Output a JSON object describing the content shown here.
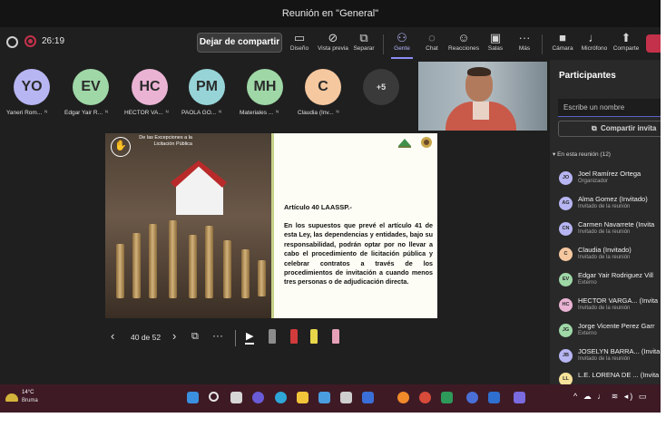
{
  "window": {
    "title": "Reunión en \"General\""
  },
  "toolbar": {
    "timer": "26:19",
    "stop_sharing_label": "Dejar de compartir",
    "buttons": [
      {
        "label": "Diseño",
        "icon": "layout-icon"
      },
      {
        "label": "Vista previa",
        "icon": "eye-off-icon"
      },
      {
        "label": "Separar",
        "icon": "popout-icon"
      },
      {
        "label": "Gente",
        "icon": "people-icon"
      },
      {
        "label": "Chat",
        "icon": "chat-icon"
      },
      {
        "label": "Reacciones",
        "icon": "reactions-icon"
      },
      {
        "label": "Salas",
        "icon": "rooms-icon"
      },
      {
        "label": "Más",
        "icon": "more-icon"
      },
      {
        "label": "Cámara",
        "icon": "camera-icon"
      },
      {
        "label": "Micrófono",
        "icon": "mic-off-icon"
      },
      {
        "label": "Comparte",
        "icon": "share-icon"
      }
    ]
  },
  "participants_strip": [
    {
      "initials": "YO",
      "name": "Yaneri Rom...",
      "color": "#b7b5f2"
    },
    {
      "initials": "EV",
      "name": "Edgar Yair R...",
      "color": "#9fd7a7"
    },
    {
      "initials": "HC",
      "name": "HECTOR VA...",
      "color": "#eab3d4"
    },
    {
      "initials": "PM",
      "name": "PAOLA GO...",
      "color": "#97d4d8"
    },
    {
      "initials": "MH",
      "name": "Materiales ...",
      "color": "#9fd7a7"
    },
    {
      "initials": "C",
      "name": "Claudia (Inv...",
      "color": "#f6c8a0"
    }
  ],
  "overflow_count": "+5",
  "slide": {
    "ribbon_text": "De las Excepciones a la Licitación Pública",
    "article_title": "Artículo 40 LAASSP.-",
    "article_body": "En los supuestos que prevé el artículo 41 de esta Ley, las dependencias y entidades, bajo su responsabilidad, podrán optar por no llevar a cabo el procedimiento de licitación pública y celebrar contratos a través de los procedimientos de invitación a cuando menos tres personas o de adjudicación directa."
  },
  "slide_controls": {
    "prev_icon": "‹",
    "page_label": "40 de 52",
    "next_icon": "›",
    "more_icon": "···"
  },
  "panel": {
    "title": "Participantes",
    "search_placeholder": "Escribe un nombre",
    "invite_label": "Compartir invita",
    "section_label": "En esta reunión (12)",
    "people": [
      {
        "initials": "JO",
        "name": "Joel Ramírez Ortega",
        "role": "Organizador",
        "color": "#b7b5f2"
      },
      {
        "initials": "AG",
        "name": "Alma Gomez (Invitado)",
        "role": "Invitado de la reunión",
        "color": "#b7b5f2"
      },
      {
        "initials": "CN",
        "name": "Carmen Navarrete (Invita",
        "role": "Invitado de la reunión",
        "color": "#b7b5f2"
      },
      {
        "initials": "C",
        "name": "Claudia (Invitado)",
        "role": "Invitado de la reunión",
        "color": "#f6c8a0"
      },
      {
        "initials": "EV",
        "name": "Edgar Yair Rodriguez Vill",
        "role": "Externo",
        "color": "#9fd7a7"
      },
      {
        "initials": "HC",
        "name": "HECTOR VARGA... (Invita",
        "role": "Invitado de la reunión",
        "color": "#eab3d4"
      },
      {
        "initials": "JG",
        "name": "Jorge Vicente Perez Garr",
        "role": "Externo",
        "color": "#9fd7a7"
      },
      {
        "initials": "JB",
        "name": "JOSELYN BARRA... (Invita",
        "role": "Invitado de la reunión",
        "color": "#b7b5f2"
      },
      {
        "initials": "LL",
        "name": "L.E. LORENA DE ... (Invita",
        "role": "",
        "color": "#f6e29a"
      }
    ]
  },
  "taskbar": {
    "temperature": "14°C",
    "condition": "Bruma"
  },
  "colors": {
    "accent": "#5b5fc7",
    "hangup": "#c4314b",
    "taskbar": "#3e1a25"
  }
}
